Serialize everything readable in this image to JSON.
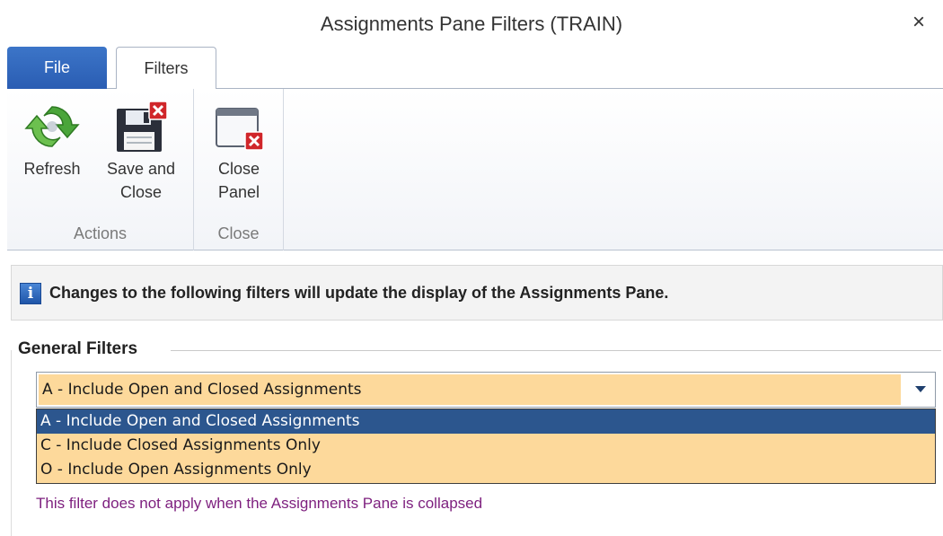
{
  "window": {
    "title": "Assignments Pane Filters (TRAIN)",
    "close_glyph": "×"
  },
  "tabs": [
    {
      "label": "File",
      "active": false
    },
    {
      "label": "Filters",
      "active": true
    }
  ],
  "ribbon": {
    "groups": [
      {
        "label": "Actions",
        "buttons": [
          {
            "label": "Refresh",
            "icon": "refresh-icon"
          },
          {
            "label": "Save and\nClose",
            "icon": "save-and-close-icon"
          }
        ]
      },
      {
        "label": "Close",
        "buttons": [
          {
            "label": "Close\nPanel",
            "icon": "close-panel-icon"
          }
        ]
      }
    ]
  },
  "info": {
    "icon": "info-icon",
    "text": "Changes to the following filters will update the display of the Assignments Pane."
  },
  "general_filters": {
    "title": "General Filters",
    "combo": {
      "value": "A - Include Open and Closed Assignments",
      "options": [
        {
          "label": "A - Include Open and Closed Assignments",
          "selected": true
        },
        {
          "label": "C - Include Closed Assignments Only",
          "selected": false
        },
        {
          "label": "O - Include Open Assignments Only",
          "selected": false
        }
      ]
    },
    "note": "This filter does not apply when the Assignments Pane is collapsed"
  },
  "colors": {
    "file_tab": "#2a5db3",
    "combo_highlight": "#fdd99b",
    "selected_option": "#2c568e",
    "note_text": "#7d1f7e"
  }
}
